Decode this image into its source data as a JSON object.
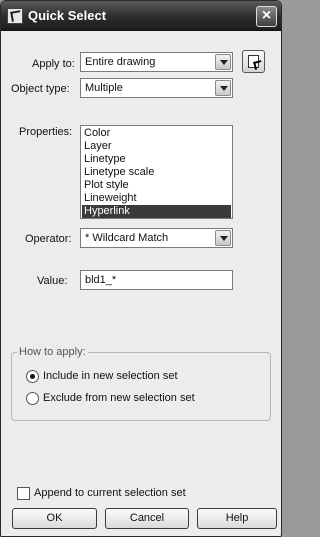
{
  "window": {
    "title": "Quick Select"
  },
  "apply_to": {
    "label": "Apply to:",
    "value": "Entire drawing"
  },
  "object_type": {
    "label": "Object type:",
    "value": "Multiple"
  },
  "properties": {
    "label": "Properties:",
    "items": [
      "Color",
      "Layer",
      "Linetype",
      "Linetype scale",
      "Plot style",
      "Lineweight",
      "Hyperlink"
    ],
    "selected": "Hyperlink"
  },
  "operator": {
    "label": "Operator:",
    "value": "* Wildcard Match"
  },
  "value_field": {
    "label": "Value:",
    "value": "bld1_*"
  },
  "how_to_apply": {
    "title": "How to apply:",
    "options": [
      "Include in new selection set",
      "Exclude from new selection set"
    ],
    "selected": "Include in new selection set"
  },
  "append": {
    "label": "Append to current selection set",
    "checked": false
  },
  "buttons": {
    "ok": "OK",
    "cancel": "Cancel",
    "help": "Help"
  }
}
